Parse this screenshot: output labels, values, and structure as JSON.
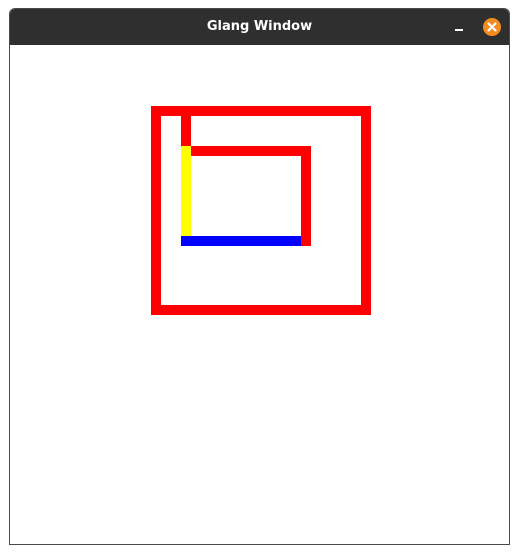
{
  "window": {
    "title": "Glang Window"
  },
  "colors": {
    "titlebar": "#2f2f2f",
    "title_text": "#ffffff",
    "close_button": "#f28c1f",
    "canvas_background": "#ffffff",
    "red": "#ff0000",
    "yellow": "#ffff00",
    "blue": "#0000ff"
  },
  "icons": {
    "minimize": "minimize-icon",
    "close": "close-icon"
  }
}
